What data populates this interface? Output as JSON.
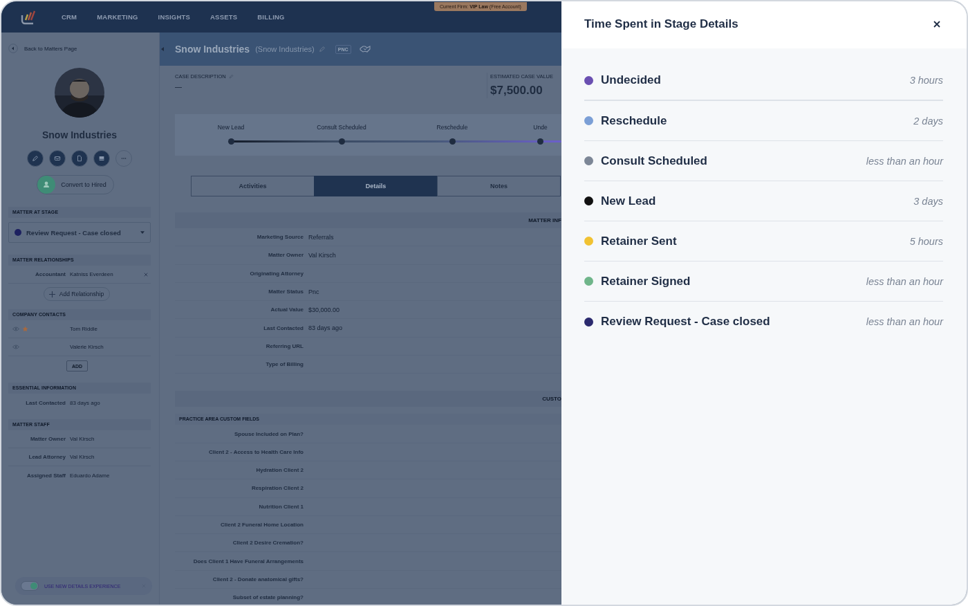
{
  "top_nav": {
    "items": [
      "CRM",
      "MARKETING",
      "INSIGHTS",
      "ASSETS",
      "BILLING"
    ],
    "firm_badge": "Current Firm: **VIP Law** (Free Account)"
  },
  "sidebar": {
    "back_link": "Back to Matters Page",
    "name": "Snow Industries",
    "convert_button": "Convert to Hired",
    "stage": {
      "title": "MATTER AT STAGE",
      "value": "Review Request - Case closed"
    },
    "relationships": {
      "title": "MATTER RELATIONSHIPS",
      "items": [
        {
          "role": "Accountant",
          "name": "Katniss Everdeen"
        }
      ],
      "add_button": "Add Relationship"
    },
    "contacts": {
      "title": "COMPANY CONTACTS",
      "items": [
        {
          "name": "Tom Riddle",
          "starred": true
        },
        {
          "name": "Valerie Kirsch",
          "starred": false
        }
      ],
      "add_button": "ADD"
    },
    "essential": {
      "title": "ESSENTIAL INFORMATION",
      "fields": [
        {
          "label": "Last Contacted",
          "value": "83 days ago"
        }
      ]
    },
    "staff": {
      "title": "MATTER STAFF",
      "fields": [
        {
          "label": "Matter Owner",
          "value": "Val Kirsch"
        },
        {
          "label": "Lead Attorney",
          "value": "Val Kirsch"
        },
        {
          "label": "Assigned Staff",
          "value": "Eduardo Adame"
        }
      ]
    },
    "toggle": {
      "label": "USE NEW DETAILS EXPERIENCE",
      "on": true
    }
  },
  "main": {
    "header": {
      "title": "Snow Industries",
      "subtitle": "(Snow Industries)",
      "tag": "PNC"
    },
    "case_description": {
      "label": "CASE DESCRIPTION",
      "value": "—"
    },
    "estimated_value": {
      "label": "ESTIMATED CASE VALUE",
      "value": "$7,500.00"
    },
    "stages": [
      "New Lead",
      "Consult Scheduled",
      "Reschedule",
      "Unde"
    ],
    "tabs": [
      {
        "label": "Activities",
        "selected": false
      },
      {
        "label": "Details",
        "selected": true
      },
      {
        "label": "Notes",
        "selected": false
      }
    ],
    "matter_info": {
      "title": "MATTER INF",
      "fields": [
        {
          "label": "Marketing Source",
          "value": "Referrals"
        },
        {
          "label": "Matter Owner",
          "value": "Val Kirsch"
        },
        {
          "label": "Originating Attorney"
        },
        {
          "label": "Matter Status",
          "value": "Pnc"
        },
        {
          "label": "Actual Value",
          "value": "$30,000.00"
        },
        {
          "label": "Last Contacted",
          "value": "83 days ago"
        },
        {
          "label": "Referring URL"
        },
        {
          "label": "Type of Billing"
        }
      ]
    },
    "custom": {
      "title": "CUSTO",
      "subtitle": "PRACTICE AREA CUSTOM FIELDS",
      "fields": [
        "Spouse Included on Plan?",
        "Client 2 - Access to Health Care Info",
        "Hydration Client 2",
        "Respiration Client 2",
        "Nutrition Client 1",
        "Client 2 Funeral Home Location",
        "Client 2 Desire Cremation?",
        "Does Client 1 Have Funeral Arrangements",
        "Client 2 - Donate anatomical gifts?",
        "Subset of estate planning?"
      ]
    }
  },
  "panel": {
    "title": "Time Spent in Stage Details",
    "stages": [
      {
        "name": "Undecided",
        "duration": "3 hours",
        "color": "#6a4fb1"
      },
      {
        "name": "Reschedule",
        "duration": "2 days",
        "color": "#7b9fd6"
      },
      {
        "name": "Consult Scheduled",
        "duration": "less than an hour",
        "color": "#7c8696"
      },
      {
        "name": "New Lead",
        "duration": "3 days",
        "color": "#111111"
      },
      {
        "name": "Retainer Sent",
        "duration": "5 hours",
        "color": "#f1c232"
      },
      {
        "name": "Retainer Signed",
        "duration": "less than an hour",
        "color": "#6fb58a"
      },
      {
        "name": "Review Request - Case closed",
        "duration": "less than an hour",
        "color": "#2b2a6e"
      }
    ]
  }
}
